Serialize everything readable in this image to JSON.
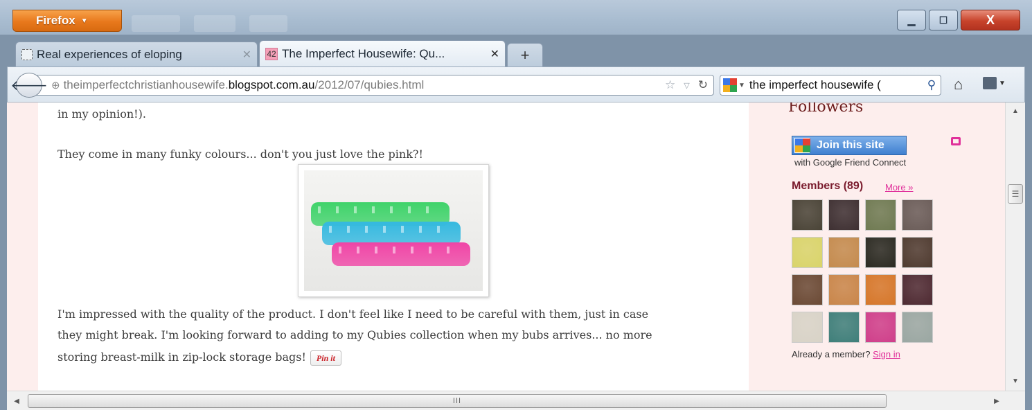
{
  "browser": {
    "menu_button": "Firefox",
    "window_controls": {
      "minimize": "▁",
      "maximize": "☐",
      "close": "X"
    }
  },
  "tabs": [
    {
      "label": "Real experiences of eloping",
      "active": false,
      "favicon": "blank-page-icon"
    },
    {
      "label": "The Imperfect Housewife: Qu...",
      "active": true,
      "favicon_text": "42"
    }
  ],
  "new_tab_label": "+",
  "navbar": {
    "url_prefix": "theimperfectchristianhousewife.",
    "url_host": "blogspot.com.au",
    "url_path": "/2012/07/qubies.html",
    "search_text": "the imperfect housewife (",
    "icons": [
      "back-icon",
      "star-icon",
      "dropdown-icon",
      "reload-icon",
      "google-icon",
      "search-icon",
      "home-icon",
      "bookmarks-icon"
    ]
  },
  "post": {
    "p1": "in my opinion!).",
    "p2": "They come in many funky colours... don't you just love the pink?!",
    "p3_line1": "I'm impressed with the quality of the product. I don't feel like I need to be careful with them, just in case",
    "p3_line2": "they might break. I'm looking forward to adding to my Qubies collection when my bubs arrives... no more",
    "p3_line3": "storing breast-milk in zip-lock storage bags!",
    "pin_label": "Pin it",
    "tray_colors": [
      "#3fd36a",
      "#35b9e0",
      "#f045a6"
    ]
  },
  "sidebar": {
    "heading": "Followers",
    "join_label": "Join this site",
    "join_sub": "with Google Friend Connect",
    "members_label": "Members (89)",
    "more_label": "More »",
    "already_text": "Already a member?",
    "sign_in": "Sign in",
    "avatar_colors": [
      "#4a4437",
      "#3e3032",
      "#6f7a52",
      "#6a5c58",
      "#d9d46a",
      "#c48b4e",
      "#2b2a22",
      "#4f3b30",
      "#6b4a35",
      "#c9864a",
      "#d6772a",
      "#4e2a32",
      "#d8d3c7",
      "#3f7f7a",
      "#cf3f8a",
      "#9aa7a2"
    ]
  },
  "scroll": {
    "h_grip": "III",
    "v_grip": "☰"
  }
}
